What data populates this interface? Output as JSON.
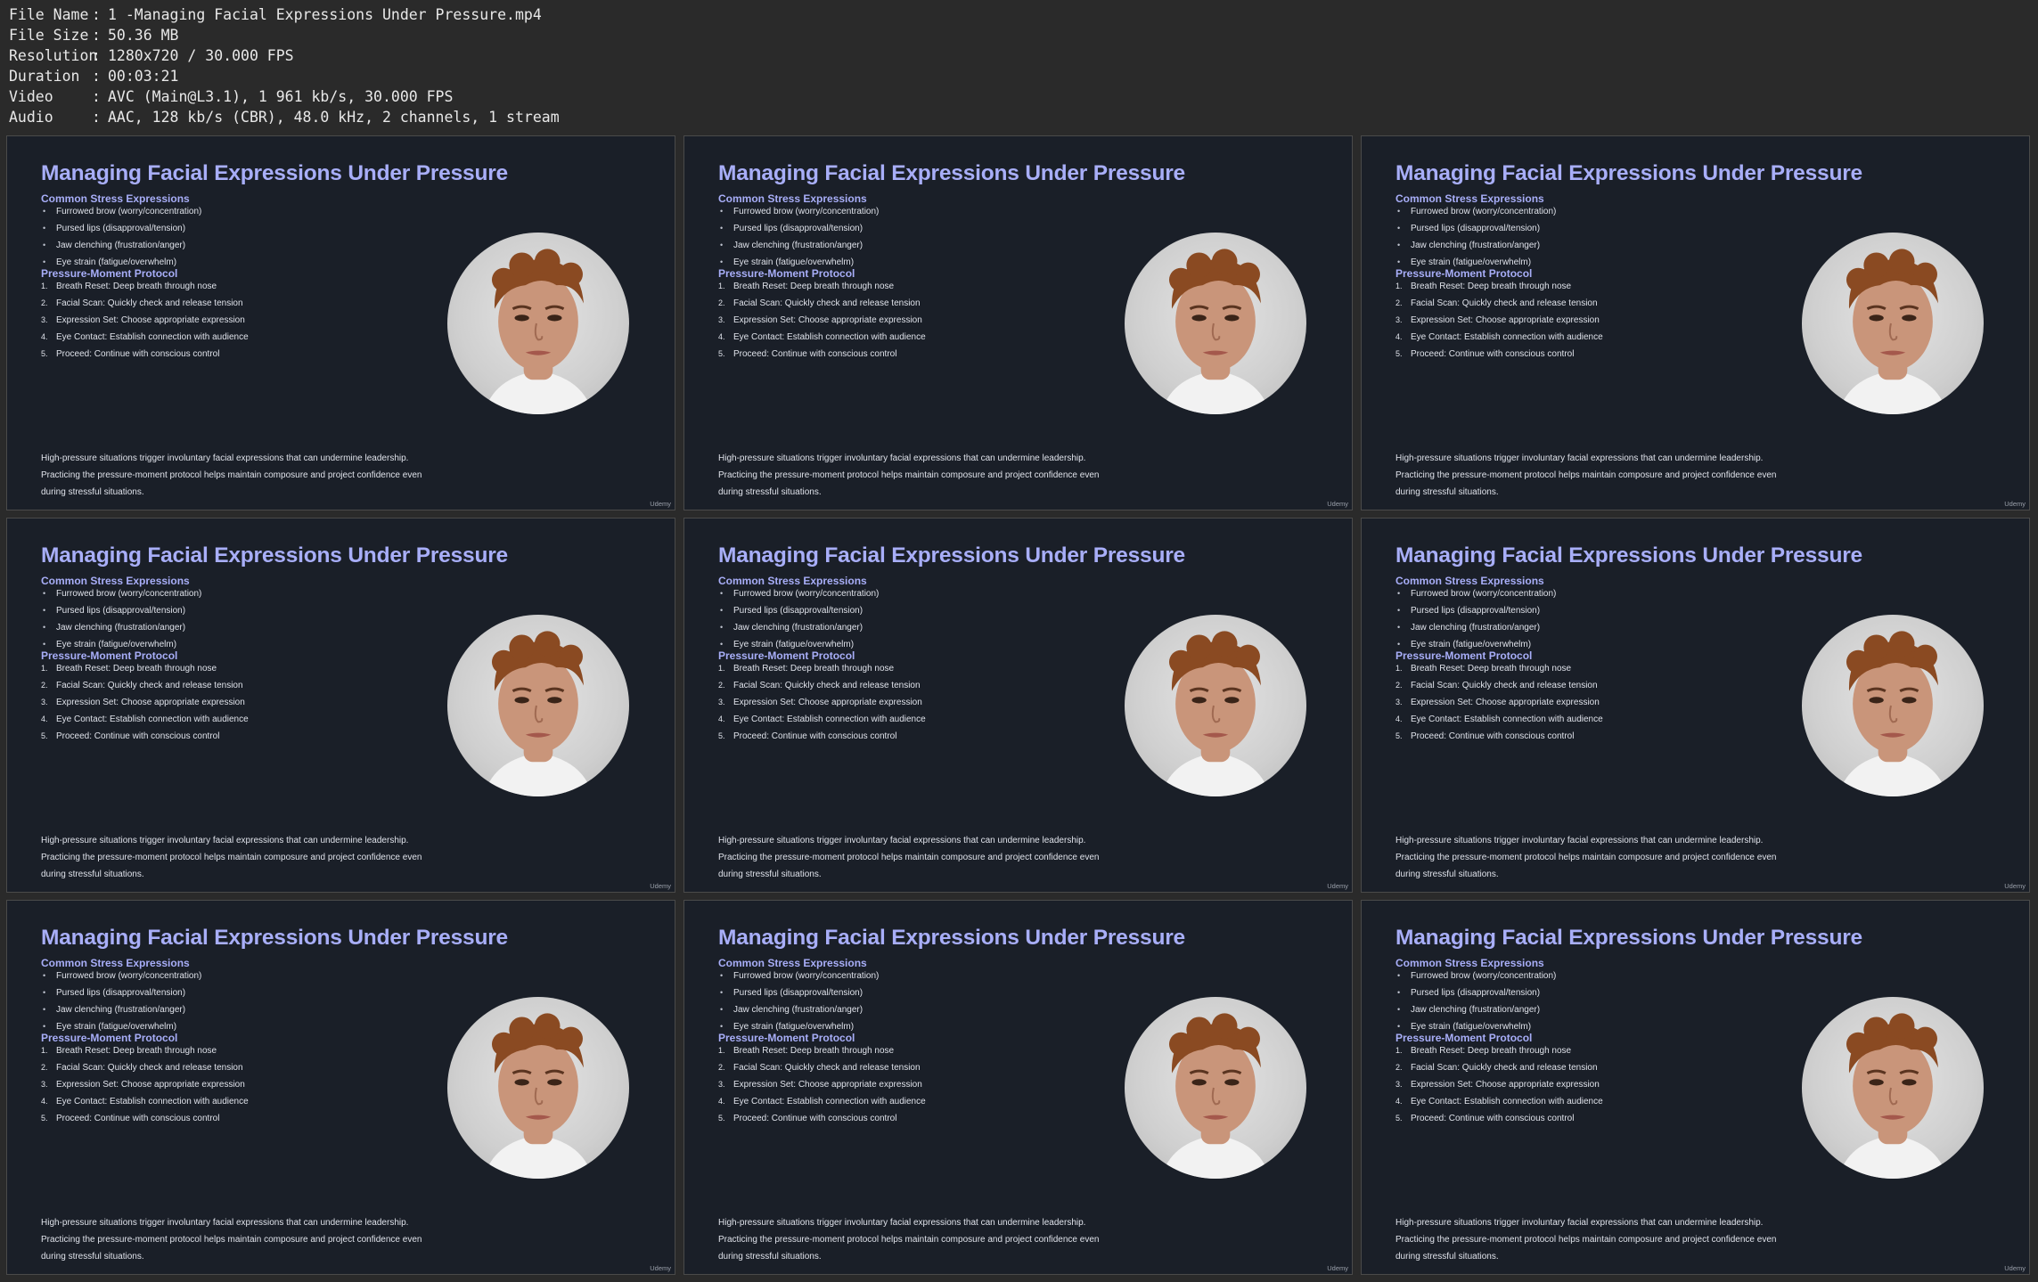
{
  "file_info": [
    {
      "key": "File Name",
      "value": "1 -Managing Facial Expressions Under Pressure.mp4"
    },
    {
      "key": "File Size",
      "value": "50.36 MB"
    },
    {
      "key": "Resolution",
      "value": "1280x720 / 30.000 FPS"
    },
    {
      "key": "Duration",
      "value": "00:03:21"
    },
    {
      "key": "Video",
      "value": "AVC (Main@L3.1), 1 961 kb/s, 30.000 FPS"
    },
    {
      "key": "Audio",
      "value": "AAC, 128 kb/s (CBR), 48.0 kHz, 2 channels, 1 stream"
    }
  ],
  "separator": ":",
  "slide": {
    "title": "Managing Facial Expressions Under Pressure",
    "section1_heading": "Common Stress Expressions",
    "section1_items": [
      "Furrowed brow (worry/concentration)",
      "Pursed lips (disapproval/tension)",
      "Jaw clenching (frustration/anger)",
      "Eye strain (fatigue/overwhelm)"
    ],
    "section2_heading": "Pressure-Moment Protocol",
    "section2_items": [
      {
        "num": "1.",
        "text": "Breath Reset: Deep breath through nose"
      },
      {
        "num": "2.",
        "text": "Facial Scan: Quickly check and release tension"
      },
      {
        "num": "3.",
        "text": "Expression Set: Choose appropriate expression"
      },
      {
        "num": "4.",
        "text": "Eye Contact: Establish connection with audience"
      },
      {
        "num": "5.",
        "text": "Proceed: Continue with conscious control"
      }
    ],
    "paragraph_lines": [
      "High-pressure situations trigger involuntary facial expressions that can undermine leadership.",
      "Practicing the pressure-moment protocol helps maintain composure and project confidence even",
      "during stressful situations."
    ],
    "brand": "Udemy"
  },
  "frame_count": 9,
  "colors": {
    "slide_bg": "#1a1f28",
    "accent": "#a8aef8",
    "text": "#dfe2ea",
    "hair": "#8a4a22",
    "skin": "#c9957a"
  }
}
